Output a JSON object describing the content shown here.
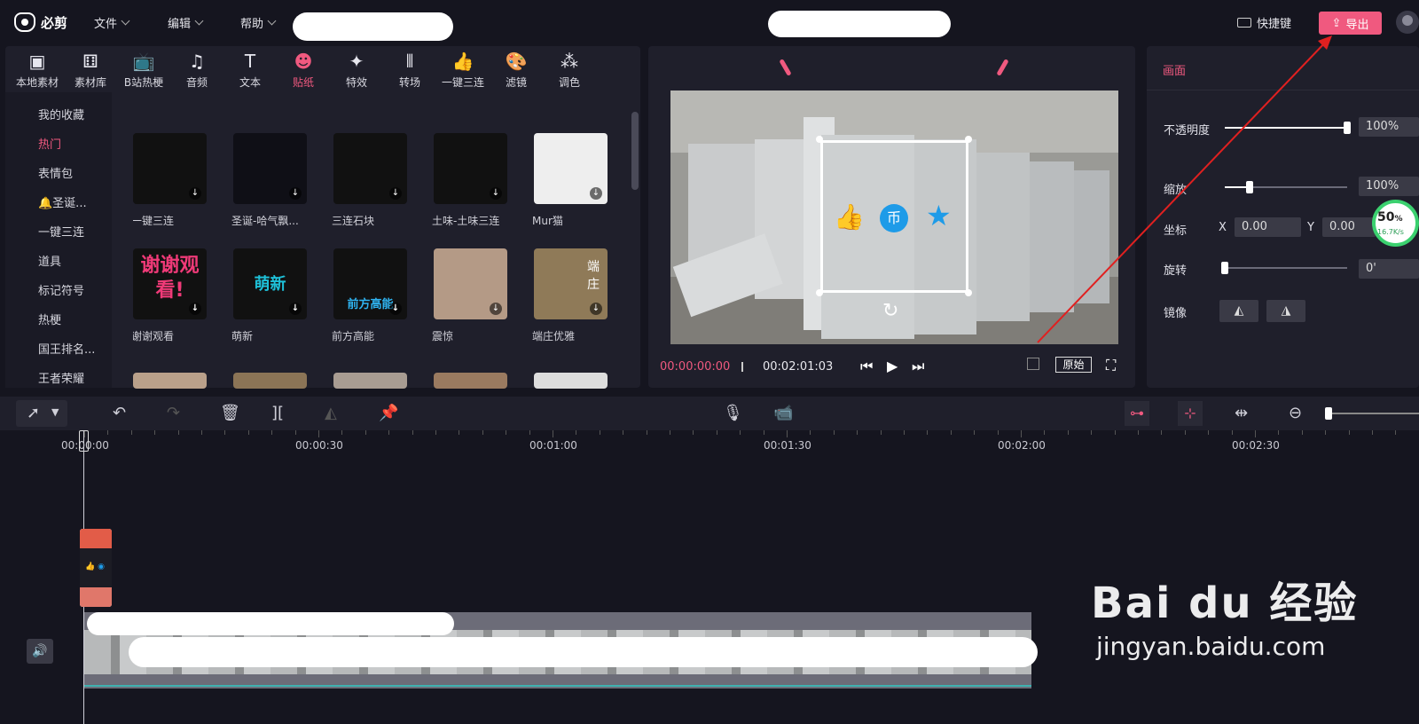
{
  "app": {
    "name": "必剪",
    "menus": [
      "文件",
      "编辑",
      "帮助"
    ],
    "shortcut_label": "快捷键",
    "export_label": "导出"
  },
  "toolbar": {
    "items": [
      {
        "label": "本地素材",
        "icon": "upload-folder-icon"
      },
      {
        "label": "素材库",
        "icon": "dice-icon"
      },
      {
        "label": "B站热梗",
        "icon": "bilibili-tv-icon"
      },
      {
        "label": "音频",
        "icon": "music-note-icon"
      },
      {
        "label": "文本",
        "icon": "text-t-icon"
      },
      {
        "label": "贴纸",
        "icon": "sticker-icon",
        "active": true
      },
      {
        "label": "特效",
        "icon": "star-wand-icon"
      },
      {
        "label": "转场",
        "icon": "transition-icon"
      },
      {
        "label": "一键三连",
        "icon": "thumbs-up-icon"
      },
      {
        "label": "滤镜",
        "icon": "palette-icon"
      },
      {
        "label": "调色",
        "icon": "color-circles-icon"
      }
    ]
  },
  "categories": [
    {
      "label": "我的收藏"
    },
    {
      "label": "热门",
      "active": true
    },
    {
      "label": "表情包"
    },
    {
      "label": "🔔圣诞..."
    },
    {
      "label": "一键三连"
    },
    {
      "label": "道具"
    },
    {
      "label": "标记符号"
    },
    {
      "label": "热梗"
    },
    {
      "label": "国王排名..."
    },
    {
      "label": "王者荣耀"
    }
  ],
  "stickers": [
    {
      "name": "一键三连",
      "text": ""
    },
    {
      "name": "圣诞-哈气飘...",
      "text": ""
    },
    {
      "name": "三连石块",
      "text": ""
    },
    {
      "name": "土味-土味三连",
      "text": ""
    },
    {
      "name": "Mur猫",
      "text": ""
    },
    {
      "name": "谢谢观看",
      "text": "谢谢观看!"
    },
    {
      "name": "萌新",
      "text": "萌新"
    },
    {
      "name": "前方高能",
      "text": "前方高能"
    },
    {
      "name": "震惊",
      "text": ""
    },
    {
      "name": "端庄优雅",
      "text": "端庄"
    }
  ],
  "preview": {
    "current_time": "00:00:00:00",
    "total_time": "00:02:01:03",
    "original_label": "原始"
  },
  "properties": {
    "section": "画面",
    "opacity": {
      "label": "不透明度",
      "value": "100%",
      "level": 1.0
    },
    "scale": {
      "label": "缩放",
      "value": "100%",
      "level": 0.2
    },
    "position": {
      "label": "坐标",
      "x_label": "X",
      "x_value": "0.00",
      "y_label": "Y",
      "y_value": "0.00"
    },
    "rotation": {
      "label": "旋转",
      "value": "0'",
      "level": 0.0
    },
    "mirror": {
      "label": "镜像"
    }
  },
  "perf_badge": {
    "percent": "50",
    "unit": "%",
    "speed": "16.7K/s"
  },
  "timeline": {
    "ticks": [
      "00:00:00",
      "00:00:30",
      "00:01:00",
      "00:01:30",
      "00:02:00",
      "00:02:30"
    ]
  },
  "watermark": {
    "brand": "Bai du 经验",
    "url": "jingyan.baidu.com"
  },
  "colors": {
    "accent": "#f0597f",
    "bg": "#15151f",
    "panel": "#1f1f2b"
  }
}
